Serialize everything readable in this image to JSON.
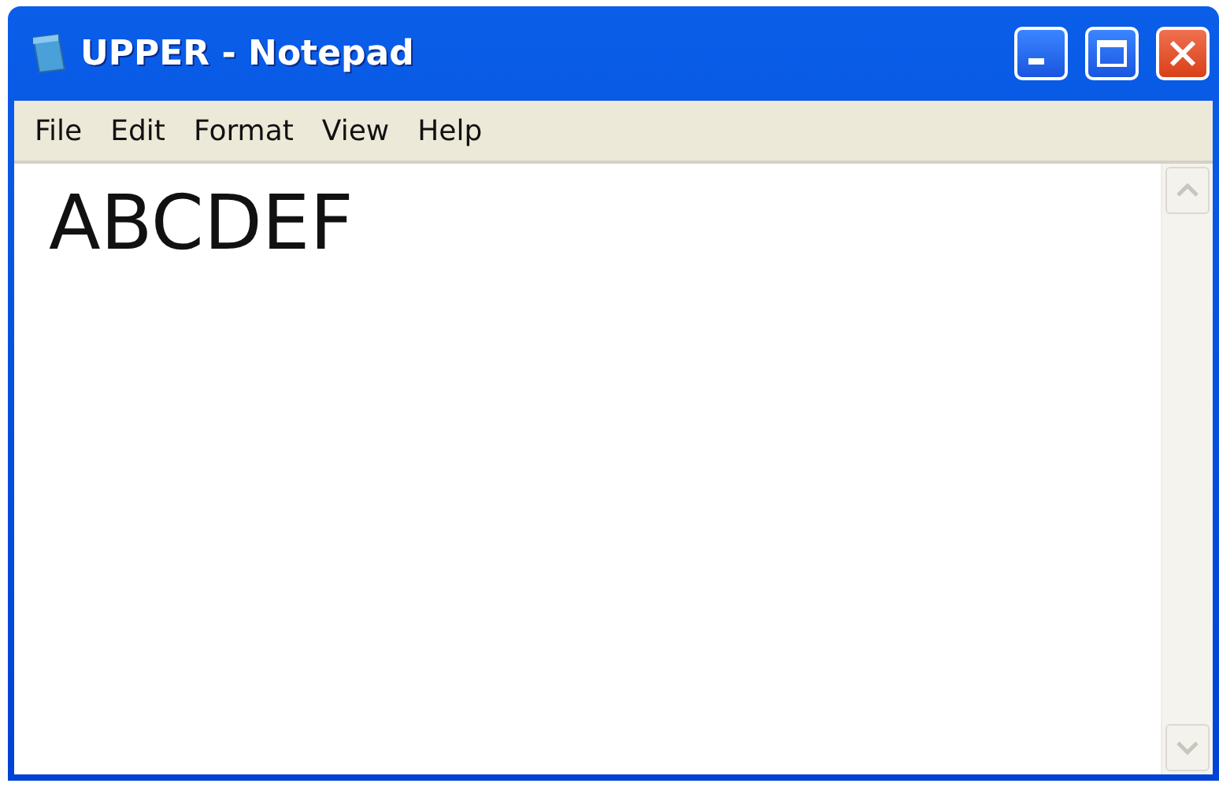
{
  "window": {
    "title": "UPPER - Notepad"
  },
  "menu": [
    "File",
    "Edit",
    "Format",
    "View",
    "Help"
  ],
  "document": {
    "text": "ABCDEF"
  }
}
